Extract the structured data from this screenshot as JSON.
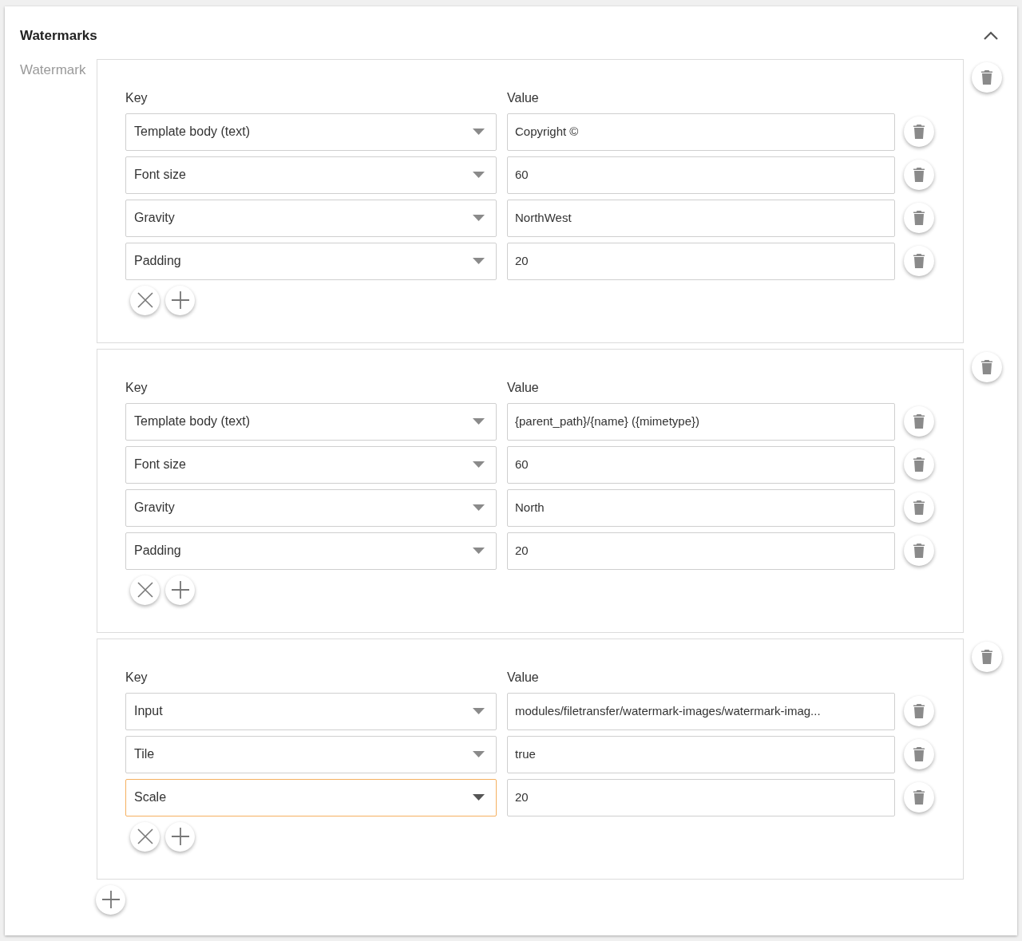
{
  "section": {
    "title": "Watermarks",
    "expanded": true,
    "field_label": "Watermark"
  },
  "watermarks": [
    {
      "key_label": "Key",
      "value_label": "Value",
      "rows": [
        {
          "key": "Template body (text)",
          "value": "Copyright ©",
          "focused": false
        },
        {
          "key": "Font size",
          "value": "60",
          "focused": false
        },
        {
          "key": "Gravity",
          "value": "NorthWest",
          "focused": false
        },
        {
          "key": "Padding",
          "value": "20",
          "focused": false
        }
      ]
    },
    {
      "key_label": "Key",
      "value_label": "Value",
      "rows": [
        {
          "key": "Template body (text)",
          "value": "{parent_path}/{name} ({mimetype})",
          "focused": false
        },
        {
          "key": "Font size",
          "value": "60",
          "focused": false
        },
        {
          "key": "Gravity",
          "value": "North",
          "focused": false
        },
        {
          "key": "Padding",
          "value": "20",
          "focused": false
        }
      ]
    },
    {
      "key_label": "Key",
      "value_label": "Value",
      "rows": [
        {
          "key": "Input",
          "value": "modules/filetransfer/watermark-images/watermark-imag...",
          "focused": false
        },
        {
          "key": "Tile",
          "value": "true",
          "focused": false
        },
        {
          "key": "Scale",
          "value": "20",
          "focused": true
        }
      ]
    }
  ]
}
